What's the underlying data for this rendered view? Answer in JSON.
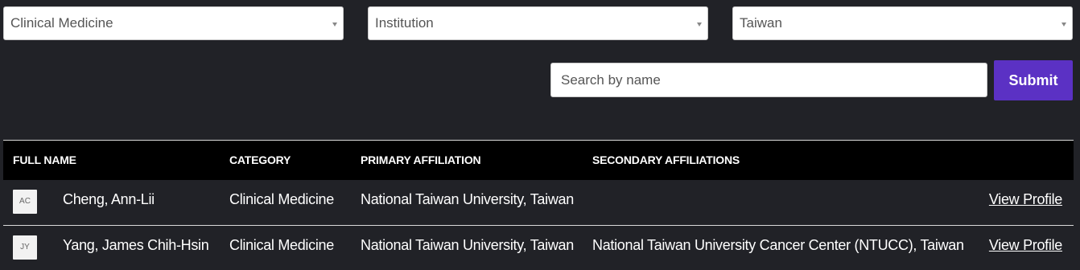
{
  "filters": {
    "category": {
      "selected": "Clinical Medicine"
    },
    "type": {
      "selected": "Institution"
    },
    "region": {
      "selected": "Taiwan"
    }
  },
  "search": {
    "placeholder": "Search by name",
    "submit_label": "Submit"
  },
  "table": {
    "headers": [
      "FULL NAME",
      "CATEGORY",
      "PRIMARY AFFILIATION",
      "SECONDARY AFFILIATIONS"
    ],
    "rows": [
      {
        "initials": "AC",
        "name": "Cheng, Ann-Lii",
        "category": "Clinical Medicine",
        "primary": "National Taiwan University, Taiwan",
        "secondary": "",
        "action": "View Profile"
      },
      {
        "initials": "JY",
        "name": "Yang, James Chih-Hsin",
        "category": "Clinical Medicine",
        "primary": "National Taiwan University, Taiwan",
        "secondary": "National Taiwan University Cancer Center (NTUCC), Taiwan",
        "action": "View Profile"
      }
    ]
  }
}
